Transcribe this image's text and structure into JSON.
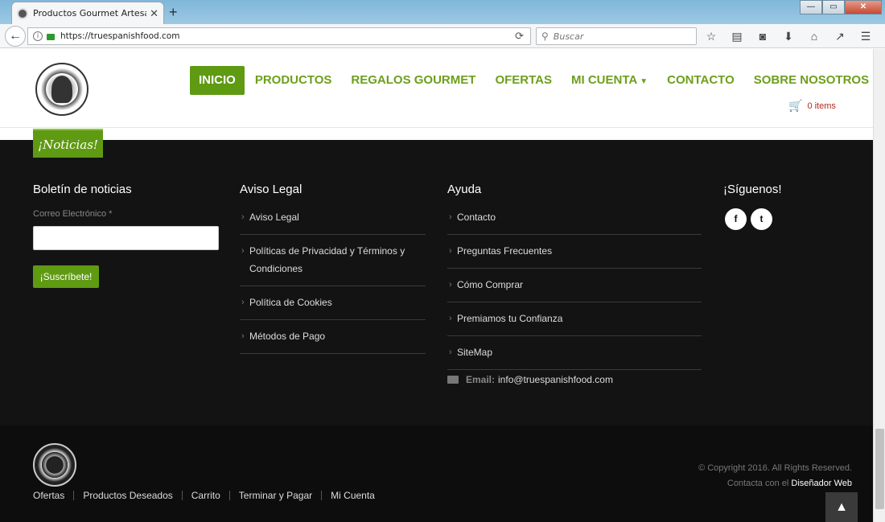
{
  "browser": {
    "tab_title": "Productos Gourmet Artesano",
    "tab_close": "✕",
    "new_tab": "+",
    "window_buttons": {
      "minimize": "—",
      "restore": "▭",
      "close": "✕"
    },
    "url": "https://truespanishfood.com",
    "search_placeholder": "Buscar"
  },
  "header": {
    "nav": [
      {
        "label": "INICIO",
        "active": true
      },
      {
        "label": "PRODUCTOS"
      },
      {
        "label": "REGALOS GOURMET"
      },
      {
        "label": "OFERTAS"
      },
      {
        "label": "MI CUENTA",
        "has_dropdown": true
      },
      {
        "label": "CONTACTO"
      },
      {
        "label": "SOBRE NOSOTROS"
      }
    ],
    "cart_label": "0 items"
  },
  "footer": {
    "noticias_tab": "¡Noticias!",
    "newsletter": {
      "title": "Boletín de noticias",
      "email_label": "Correo Electrónico *",
      "subscribe_label": "¡Suscríbete!"
    },
    "legal": {
      "title": "Aviso Legal",
      "links": [
        "Aviso Legal",
        "Políticas de Privacidad y Términos y Condiciones",
        "Política de Cookies",
        "Métodos de Pago"
      ]
    },
    "help": {
      "title": "Ayuda",
      "links": [
        "Contacto",
        "Preguntas Frecuentes",
        "Cómo Comprar",
        "Premiamos tu Confianza",
        "SiteMap"
      ],
      "email_label": "Email:",
      "email_value": "info@truespanishfood.com"
    },
    "social": {
      "title": "¡Síguenos!",
      "facebook": "f",
      "twitter": "t"
    }
  },
  "bottom": {
    "links": [
      "Ofertas",
      "Productos Deseados",
      "Carrito",
      "Terminar y Pagar",
      "Mi Cuenta"
    ],
    "copyright": "© Copyright 2016. All Rights Reserved.",
    "contact_prefix": "Contacta con el",
    "designer": "Diseñador Web"
  },
  "colors": {
    "accent_green": "#5f9a13",
    "nav_green": "#6c9f1c",
    "cart_red": "#b5281a",
    "footer_bg": "#131313"
  },
  "icons": [
    "back-arrow-icon",
    "info-icon",
    "lock-icon",
    "reload-icon",
    "search-icon",
    "bookmark-star-icon",
    "reading-list-icon",
    "pocket-icon",
    "download-icon",
    "home-icon",
    "extension-icon",
    "menu-icon",
    "cart-icon",
    "envelope-icon",
    "facebook-icon",
    "twitter-icon",
    "chevron-up-icon"
  ]
}
